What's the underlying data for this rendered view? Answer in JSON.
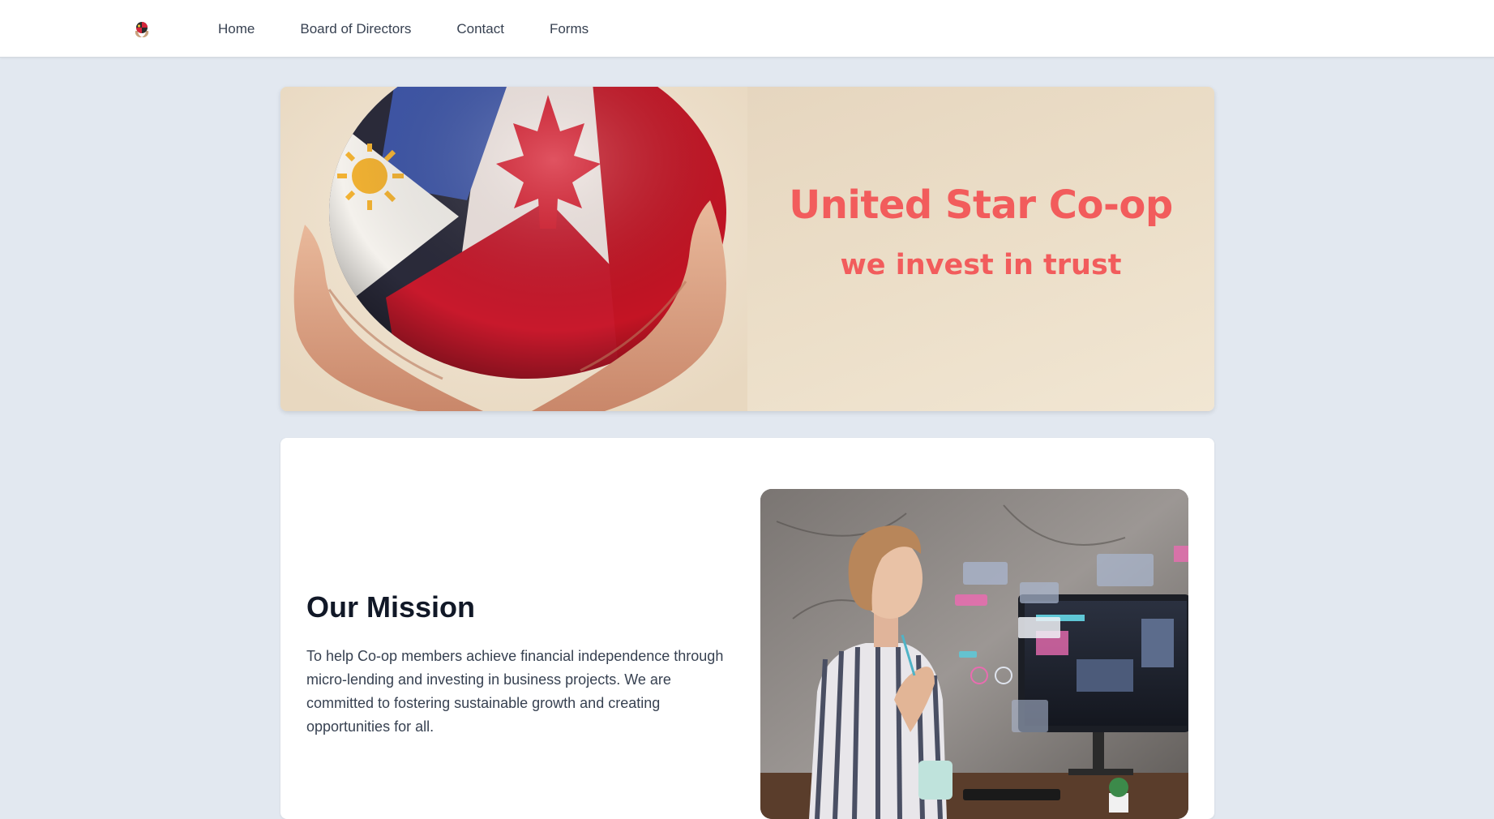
{
  "nav": {
    "logo_icon": "coop-logo-icon",
    "links": [
      "Home",
      "Board of Directors",
      "Contact",
      "Forms"
    ]
  },
  "hero": {
    "title": "United Star Co-op",
    "subtitle": "we invest in trust",
    "image_icon": "hands-holding-globe-flags-image",
    "text_color": "#f25c5c"
  },
  "mission": {
    "heading": "Our Mission",
    "body": "To help Co-op members achieve financial independence through micro-lending and investing in business projects. We are committed to fostering sustainable growth and creating opportunities for all.",
    "image_icon": "woman-at-computer-image"
  },
  "colors": {
    "page_background": "#e2e8f0",
    "accent": "#f25c5c",
    "heading": "#111827",
    "body_text": "#374151"
  }
}
